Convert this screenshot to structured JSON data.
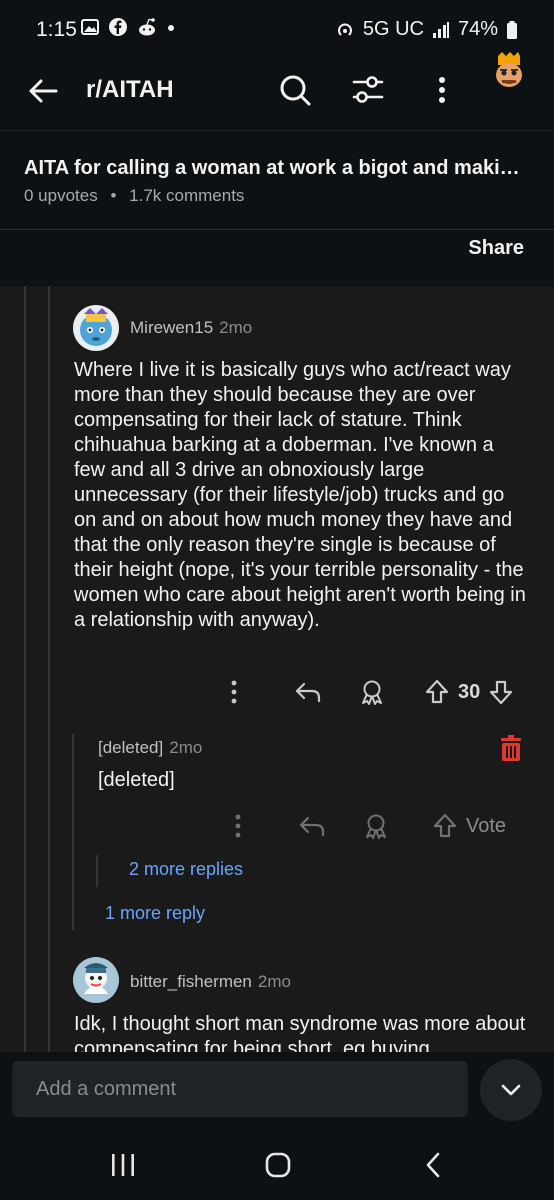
{
  "status_bar": {
    "time": "1:15",
    "network": "5G UC",
    "battery": "74%"
  },
  "header": {
    "subreddit": "r/AITAH"
  },
  "post": {
    "title": "AITA for calling a woman at work a bigot and maki…",
    "upvotes": "0 upvotes",
    "separator": "•",
    "comments": "1.7k comments",
    "share_label": "Share"
  },
  "comments": [
    {
      "author": "Mirewen15",
      "age": "2mo",
      "body": "Where I live it is basically guys who act/react way more than they should because they are over compensating for their lack of stature. Think chihuahua barking at a doberman.  I've known a few and all 3 drive an obnoxiously large unnecessary (for their lifestyle/job) trucks and go on and on about how much money they have and that the only reason they're single is because of their height (nope, it's your terrible personality - the women who care about height aren't worth being in a relationship with anyway).",
      "votes": "30"
    },
    {
      "author": "[deleted]",
      "age": "2mo",
      "body": "[deleted]",
      "vote_label": "Vote",
      "more_replies": "2 more replies"
    },
    {
      "author": "bitter_fishermen",
      "age": "2mo",
      "body": "Idk, I thought short man syndrome was more about compensating for being short, eg buying"
    }
  ],
  "thread_more_reply": "1 more reply",
  "composer": {
    "placeholder": "Add a comment"
  },
  "colors": {
    "background": "#0e1113",
    "thread_background": "#1a1a1b",
    "link": "#6aa4ff",
    "delete": "#e0382f"
  }
}
